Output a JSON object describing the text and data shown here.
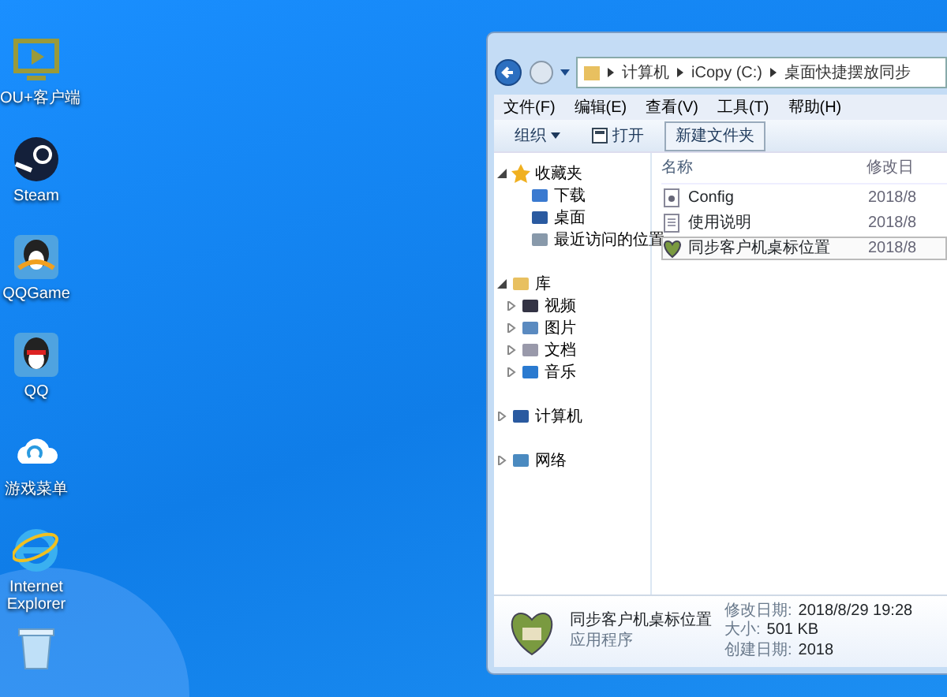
{
  "desktop_icons": [
    {
      "label": "OU+客户端",
      "kind": "monitor"
    },
    {
      "label": "Steam",
      "kind": "steam"
    },
    {
      "label": "QQGame",
      "kind": "qqgame"
    },
    {
      "label": "QQ",
      "kind": "qq"
    },
    {
      "label": "游戏菜单",
      "kind": "cloud"
    },
    {
      "label": "Internet Explorer",
      "kind": "ie"
    },
    {
      "kind": "bin"
    }
  ],
  "explorer": {
    "address": {
      "crumbs": [
        "计算机",
        "iCopy (C:)",
        "桌面快捷摆放同步"
      ]
    },
    "menu": [
      "文件(F)",
      "编辑(E)",
      "查看(V)",
      "工具(T)",
      "帮助(H)"
    ],
    "toolbar": [
      {
        "label": "组织",
        "kind": "dropdown"
      },
      {
        "label": "打开",
        "kind": "open"
      },
      {
        "label": "新建文件夹",
        "kind": "plain"
      }
    ],
    "nav": [
      {
        "label": "收藏夹",
        "kind": "star",
        "expanded": true,
        "children": [
          {
            "label": "下载",
            "kind": "download"
          },
          {
            "label": "桌面",
            "kind": "desktop"
          },
          {
            "label": "最近访问的位置",
            "kind": "recent"
          }
        ]
      },
      {
        "label": "库",
        "kind": "library",
        "expanded": true,
        "children": [
          {
            "label": "视频",
            "kind": "video",
            "expanded": false
          },
          {
            "label": "图片",
            "kind": "picture",
            "expanded": false
          },
          {
            "label": "文档",
            "kind": "doc",
            "expanded": false
          },
          {
            "label": "音乐",
            "kind": "music",
            "expanded": false
          }
        ]
      },
      {
        "label": "计算机",
        "kind": "computer",
        "expanded": false
      },
      {
        "label": "网络",
        "kind": "network",
        "expanded": false
      }
    ],
    "columns": [
      "名称",
      "修改日"
    ],
    "files": [
      {
        "name": "Config",
        "date": "2018/8",
        "kind": "config",
        "selected": false
      },
      {
        "name": "使用说明",
        "date": "2018/8",
        "kind": "text",
        "selected": false
      },
      {
        "name": "同步客户机桌标位置",
        "date": "2018/8",
        "kind": "app",
        "selected": true
      }
    ],
    "details": {
      "name": "同步客户机桌标位置",
      "type": "应用程序",
      "modified_label": "修改日期:",
      "modified": "2018/8/29 19:28",
      "size_label": "大小:",
      "size": "501 KB",
      "created_label": "创建日期:",
      "created": "2018"
    }
  }
}
